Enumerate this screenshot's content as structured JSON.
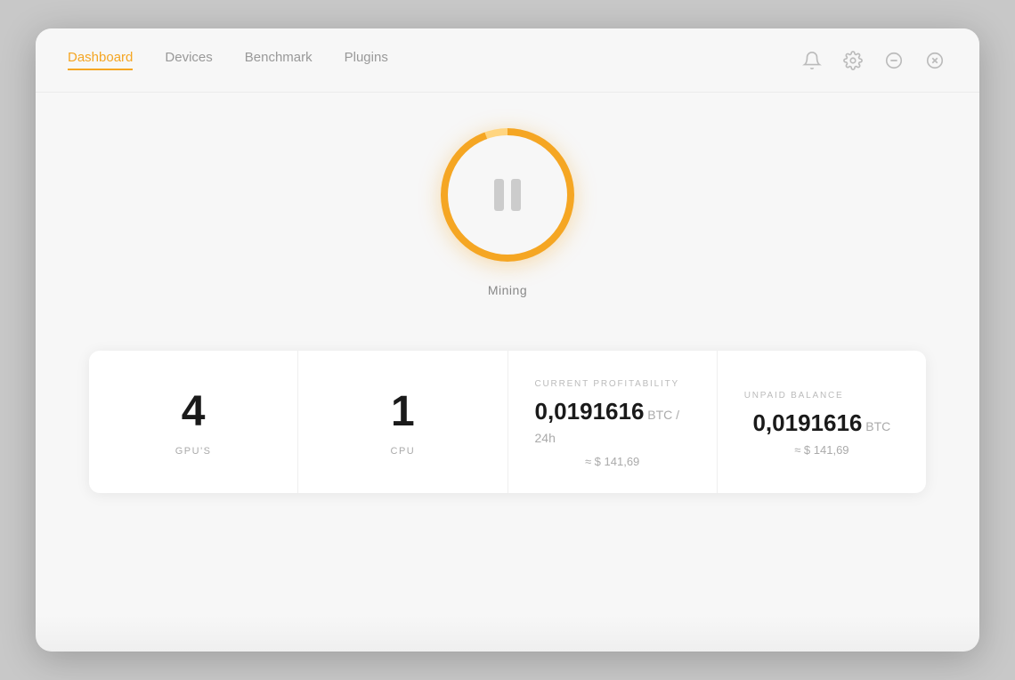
{
  "nav": {
    "links": [
      {
        "id": "dashboard",
        "label": "Dashboard",
        "active": true
      },
      {
        "id": "devices",
        "label": "Devices",
        "active": false
      },
      {
        "id": "benchmark",
        "label": "Benchmark",
        "active": false
      },
      {
        "id": "plugins",
        "label": "Plugins",
        "active": false
      }
    ],
    "icons": [
      {
        "id": "notification",
        "name": "bell-icon"
      },
      {
        "id": "settings",
        "name": "gear-icon"
      },
      {
        "id": "minimize",
        "name": "minimize-icon"
      },
      {
        "id": "close",
        "name": "close-icon"
      }
    ]
  },
  "mining": {
    "button_label": "Mining",
    "status": "paused"
  },
  "stats": [
    {
      "id": "gpu-count",
      "value": "4",
      "label": "GPU'S",
      "type": "count"
    },
    {
      "id": "cpu-count",
      "value": "1",
      "label": "CPU",
      "type": "count"
    },
    {
      "id": "current-profitability",
      "title": "CURRENT PROFITABILITY",
      "value": "0,0191616",
      "unit": " BTC / 24h",
      "approx": "≈ $ 141,69",
      "type": "btc"
    },
    {
      "id": "unpaid-balance",
      "title": "UNPAID BALANCE",
      "value": "0,0191616",
      "unit": " BTC",
      "approx": "≈ $ 141,69",
      "type": "btc"
    }
  ]
}
